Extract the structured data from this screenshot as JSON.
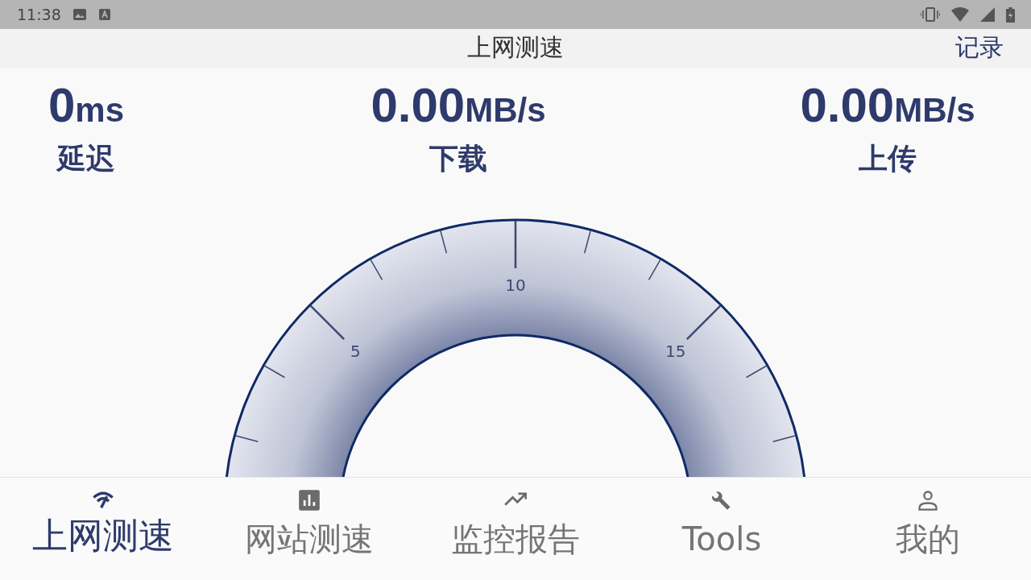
{
  "status_bar": {
    "time": "11:38"
  },
  "header": {
    "title": "上网测速",
    "action": "记录"
  },
  "stats": [
    {
      "value": "0",
      "unit": "ms",
      "label": "延迟"
    },
    {
      "value": "0.00",
      "unit": "MB/s",
      "label": "下载"
    },
    {
      "value": "0.00",
      "unit": "MB/s",
      "label": "上传"
    }
  ],
  "gauge": {
    "tick_labels": [
      "5",
      "10",
      "15"
    ]
  },
  "tabs": [
    {
      "label": "上网测速",
      "selected": true
    },
    {
      "label": "网站测速",
      "selected": false
    },
    {
      "label": "监控报告",
      "selected": false
    },
    {
      "label": "Tools",
      "selected": false
    },
    {
      "label": "我的",
      "selected": false
    }
  ]
}
